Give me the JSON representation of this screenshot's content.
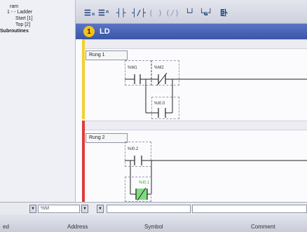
{
  "tree": {
    "items": [
      "ram",
      "1 - - Ladder",
      "Start [1]",
      "Top [2]",
      "Subroutines"
    ]
  },
  "toolbar": {
    "buttons": [
      {
        "name": "insert-rung-above-button",
        "glyph": "☰ₙ",
        "enabled": true
      },
      {
        "name": "insert-rung-below-button",
        "glyph": "☰ⁿ",
        "enabled": true
      },
      {
        "name": "no-contact-button",
        "glyph": "┤├",
        "enabled": true
      },
      {
        "name": "nc-contact-button",
        "glyph": "┤/├",
        "enabled": true
      },
      {
        "name": "coil-button",
        "glyph": "( )",
        "enabled": false
      },
      {
        "name": "negated-coil-button",
        "glyph": "(/)",
        "enabled": false
      },
      {
        "name": "branch-open-button",
        "glyph": "└┘",
        "enabled": true
      },
      {
        "name": "branch-close-button",
        "glyph": "└ҩ┘",
        "enabled": true
      },
      {
        "name": "function-block-button",
        "glyph": "卧",
        "enabled": true
      }
    ]
  },
  "section": {
    "number": "1",
    "label": "LD"
  },
  "rungs": [
    {
      "label": "Rung 1",
      "rail_color": "#f0d02e",
      "contacts": [
        "%M1",
        "%M2",
        "%I0.0"
      ]
    },
    {
      "label": "Rung 2",
      "rail_color": "#e23a3a",
      "contacts": [
        "%I0.2",
        "%I0.1"
      ]
    }
  ],
  "symbol_bar": {
    "filter_value": "%M"
  },
  "columns": [
    "ed",
    "Address",
    "Symbol",
    "Comment"
  ]
}
